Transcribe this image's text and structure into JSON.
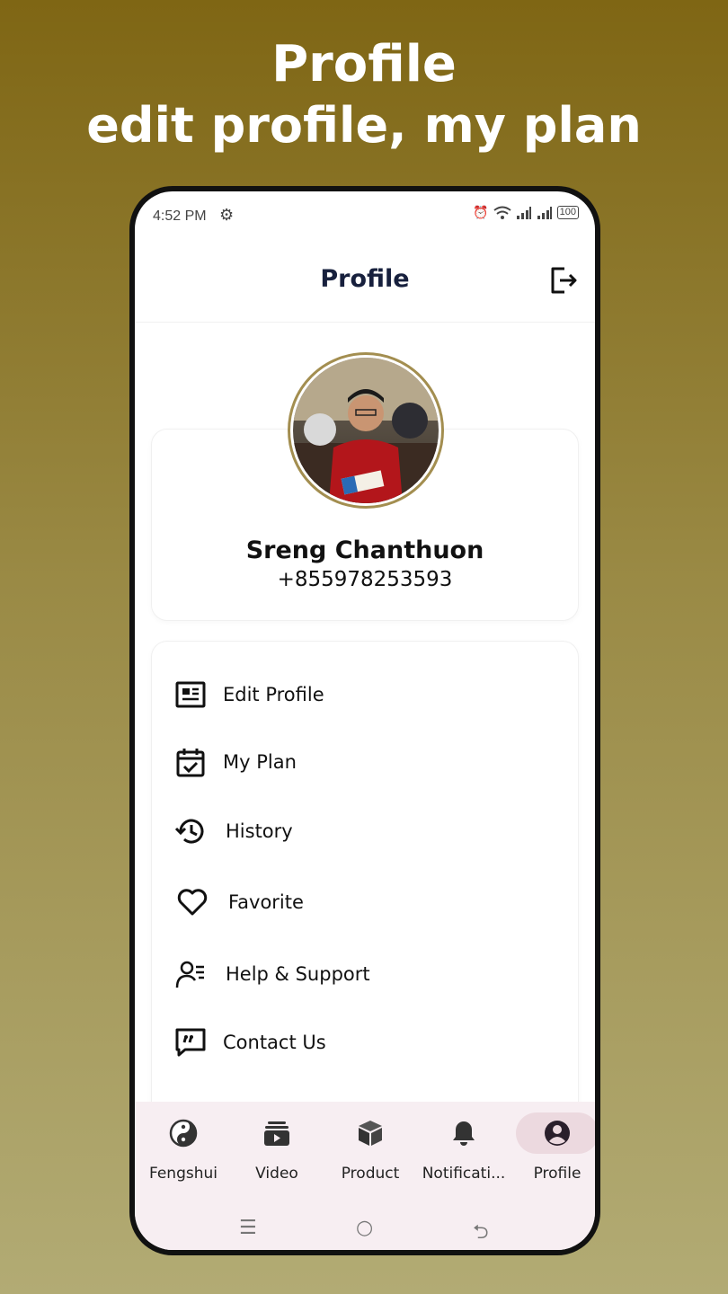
{
  "promo": {
    "line1": "Profile",
    "line2": "edit profile, my plan"
  },
  "status": {
    "time": "4:52 PM",
    "battery": "100"
  },
  "appbar": {
    "title": "Profile"
  },
  "user": {
    "name": "Sreng Chanthuon",
    "phone": "+855978253593"
  },
  "menu": [
    {
      "label": "Edit Profile",
      "icon": "profile-card-icon"
    },
    {
      "label": "My Plan",
      "icon": "calendar-check-icon"
    },
    {
      "label": "History",
      "icon": "history-icon"
    },
    {
      "label": "Favorite",
      "icon": "heart-icon"
    },
    {
      "label": "Help & Support",
      "icon": "support-icon"
    },
    {
      "label": "Contact Us",
      "icon": "chat-quote-icon"
    }
  ],
  "nav": [
    {
      "label": "Fengshui",
      "icon": "yin-yang-icon"
    },
    {
      "label": "Video",
      "icon": "video-icon"
    },
    {
      "label": "Product",
      "icon": "box-icon"
    },
    {
      "label": "Notificati...",
      "icon": "bell-icon"
    },
    {
      "label": "Profile",
      "icon": "user-circle-icon",
      "active": true
    }
  ],
  "colors": {
    "title": "#17203d",
    "nav_bg": "#f7eef2",
    "nav_active": "#ecd9df",
    "avatar_ring": "#a38e50"
  }
}
